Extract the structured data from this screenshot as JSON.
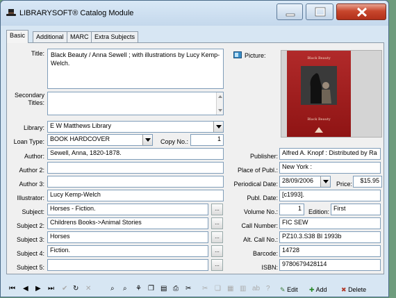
{
  "window": {
    "title": "LIBRARYSOFT® Catalog Module"
  },
  "tabs": [
    {
      "label": "Basic",
      "active": true
    },
    {
      "label": "Additional",
      "active": false
    },
    {
      "label": "MARC",
      "active": false
    },
    {
      "label": "Extra Subjects",
      "active": false
    }
  ],
  "left": {
    "title_label": "Title:",
    "title_value": "Black Beauty /  Anna Sewell ; with illustrations by Lucy Kemp-Welch.",
    "secondary_titles_label": "Secondary Titles:",
    "secondary_titles_value": "",
    "library_label": "Library:",
    "library_value": "E W Matthews Library",
    "loan_type_label": "Loan Type:",
    "loan_type_value": "BOOK HARDCOVER",
    "copy_no_label": "Copy No.:",
    "copy_no_value": "1",
    "author_label": "Author:",
    "author_value": "Sewell, Anna,   1820-1878.",
    "author2_label": "Author 2:",
    "author2_value": "",
    "author3_label": "Author 3:",
    "author3_value": "",
    "illustrator_label": "Illustrator:",
    "illustrator_value": "Lucy Kemp-Welch",
    "subject_label": "Subject:",
    "subject_value": "Horses  -  Fiction.",
    "subject2_label": "Subject 2:",
    "subject2_value": "Childrens Books->Animal Stories",
    "subject3_label": "Subject 3:",
    "subject3_value": "Horses",
    "subject4_label": "Subject 4:",
    "subject4_value": "Fiction.",
    "subject5_label": "Subject 5:",
    "subject5_value": "",
    "ellipsis": "..."
  },
  "right": {
    "picture_label": "Picture:",
    "cover_text_top": "Black Beauty",
    "cover_text_bottom": "Black Beauty",
    "publisher_label": "Publisher:",
    "publisher_value": "Alfred A. Knopf :  Distributed by Ra",
    "place_label": "Place of Publ.:",
    "place_value": "New York :",
    "periodical_label": "Periodical Date:",
    "periodical_value": "28/09/2006",
    "price_label": "Price:",
    "price_value": "$15.95",
    "publ_date_label": "Publ. Date:",
    "publ_date_value": "[c1993].",
    "volume_label": "Volume No.:",
    "volume_value": "1",
    "edition_label": "Edition:",
    "edition_value": "First",
    "call_number_label": "Call Number:",
    "call_number_value": "FIC SEW",
    "alt_call_label": "Alt. Call No.:",
    "alt_call_value": "PZ10.3.S38  Bl 1993b",
    "barcode_label": "Barcode:",
    "barcode_value": "14728",
    "isbn_label": "ISBN:",
    "isbn_value": "9780679428114"
  },
  "toolbar": {
    "edit_label": "Edit",
    "add_label": "Add",
    "delete_label": "Delete",
    "icons": [
      "first-icon",
      "prev-icon",
      "next-icon",
      "last-icon",
      "check-icon",
      "refresh-icon",
      "cancel-icon",
      "binoculars-icon",
      "binoculars-plus-icon",
      "tree-icon",
      "copy-icon",
      "print-preview-icon",
      "print-icon",
      "scissors-icon",
      "paste-icon",
      "calculator-icon",
      "chart-icon",
      "abc-icon",
      "help-icon",
      "edit-icon",
      "add-icon",
      "delete-icon"
    ]
  },
  "colors": {
    "accent": "#4a6a88",
    "close_button": "#c8472d",
    "cover_red": "#a81e1e"
  }
}
